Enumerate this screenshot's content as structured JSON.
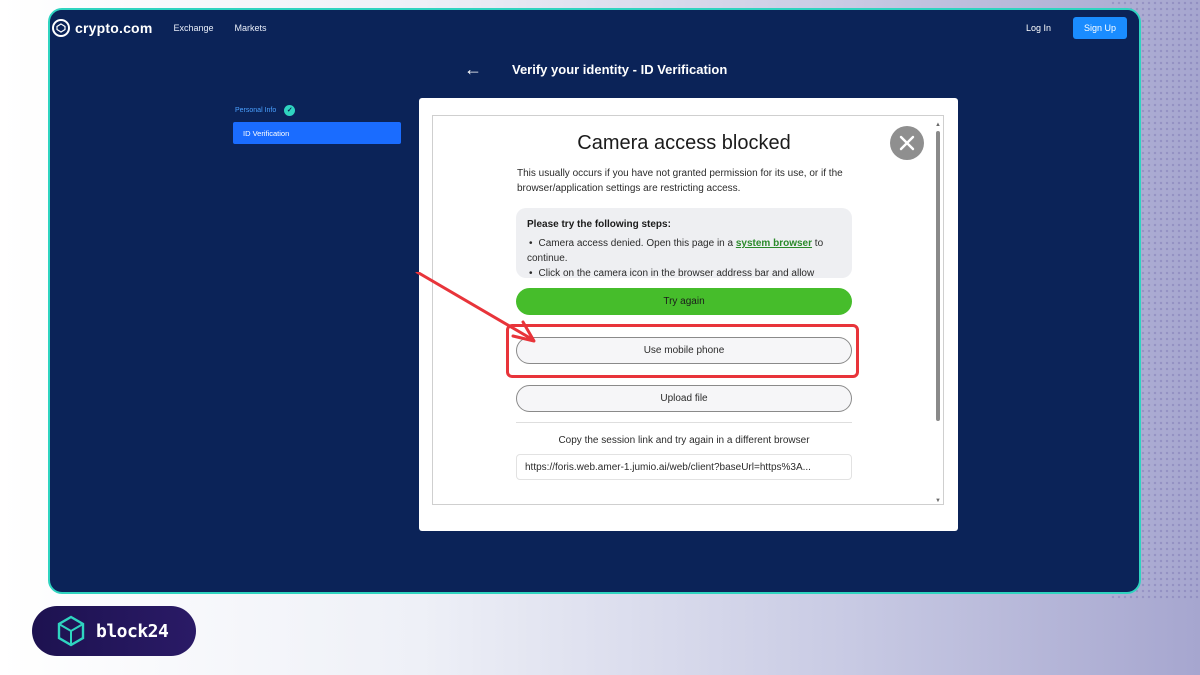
{
  "nav": {
    "logo_text": "crypto.com",
    "links": [
      "Exchange",
      "Markets"
    ],
    "login_label": "Log In",
    "signup_label": "Sign Up"
  },
  "header": {
    "back_icon": "arrow-left-icon",
    "title": "Verify your identity - ID Verification"
  },
  "steps": {
    "done_label": "Personal Info",
    "active_label": "ID Verification"
  },
  "modal": {
    "title": "Camera access blocked",
    "description": "This usually occurs if you have not granted permission for its use, or if the browser/application settings are restricting access.",
    "steps_heading": "Please try the following steps:",
    "step1_prefix": "Camera access denied. Open this page in a ",
    "step1_link": "system browser",
    "step1_suffix": " to continue.",
    "step2_partial": "Click on the camera icon in the browser address bar and allow",
    "try_again_label": "Try again",
    "mobile_label": "Use mobile phone",
    "upload_label": "Upload file",
    "copy_text": "Copy the session link and try again in a different browser",
    "session_link": "https://foris.web.amer-1.jumio.ai/web/client?baseUrl=https%3A..."
  },
  "brand": {
    "text": "block24"
  },
  "colors": {
    "app_bg": "#0b2358",
    "frame_border": "#2fd4c0",
    "accent_blue": "#1a8cff",
    "try_again_green": "#46bd2b",
    "highlight_red": "#e8343a"
  }
}
